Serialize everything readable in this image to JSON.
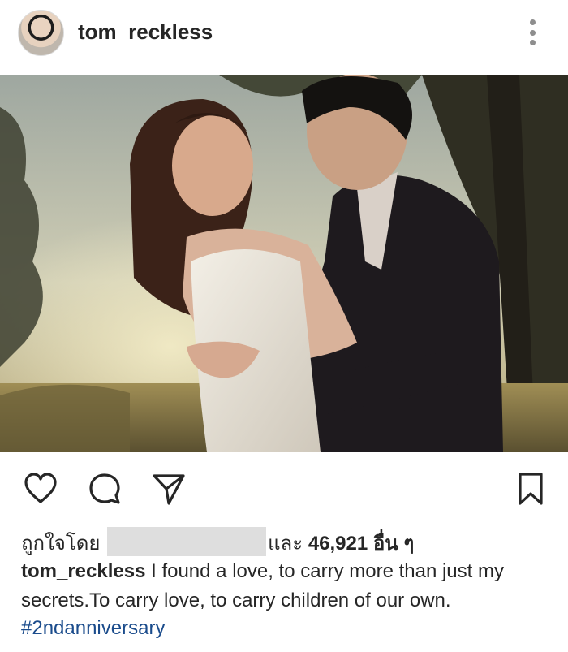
{
  "post": {
    "username": "tom_reckless",
    "menu_icon": "more-vertical-icon"
  },
  "photo": {
    "description_icon": "wedding-photo",
    "colors": {
      "sky": "#c8c9b0",
      "foliage": "#3a3a24",
      "dress": "#ece8e0",
      "suit": "#1e1a1e"
    }
  },
  "actions": {
    "like_icon": "heart-icon",
    "comment_icon": "comment-icon",
    "share_icon": "send-icon",
    "save_icon": "bookmark-icon"
  },
  "likes": {
    "prefix": "ถูกใจโดย",
    "joiner": "และ",
    "count": "46,921",
    "suffix": "อื่น ๆ"
  },
  "caption": {
    "username": "tom_reckless",
    "text": "I found a love, to carry more than just my secrets.To carry love, to carry children of our own.",
    "hashtag": "#2ndanniversary"
  }
}
